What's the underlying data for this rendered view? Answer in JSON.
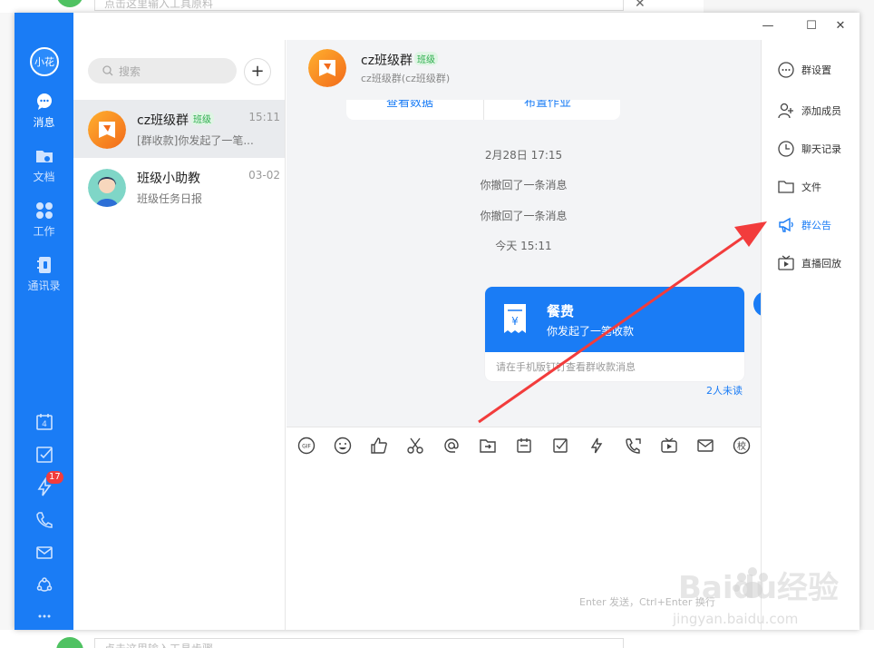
{
  "background": {
    "top_input_placeholder": "点击这里输入工具原料",
    "bottom_input_placeholder": "点击这里输入工具步骤"
  },
  "nav": {
    "avatar_text": "小花",
    "items": [
      {
        "label": "消息",
        "icon": "chat-bubble-icon"
      },
      {
        "label": "文档",
        "icon": "folder-icon"
      },
      {
        "label": "工作",
        "icon": "apps-grid-icon"
      },
      {
        "label": "通讯录",
        "icon": "contacts-icon"
      }
    ],
    "bottom_icons": [
      "calendar-icon",
      "todo-check-icon",
      "lightning-icon",
      "phone-icon",
      "mail-icon",
      "share-icon",
      "more-icon"
    ],
    "calendar_day": "4",
    "badge_count": "17"
  },
  "list": {
    "search_placeholder": "搜索",
    "add_label": "+",
    "conversations": [
      {
        "name": "cz班级群",
        "tag": "班级",
        "time": "15:11",
        "preview": "[群收款]你发起了一笔..."
      },
      {
        "name": "班级小助教",
        "time": "03-02",
        "preview": "班级任务日报"
      }
    ]
  },
  "chat": {
    "title": "cz班级群",
    "title_tag": "班级",
    "subtitle": "cz班级群(cz班级群)",
    "prev_card_left": "查看数据",
    "prev_card_right": "布置作业",
    "system_messages": [
      "2月28日 17:15",
      "你撤回了一条消息",
      "你撤回了一条消息",
      "今天 15:11"
    ],
    "payment_card": {
      "title": "餐费",
      "desc": "你发起了一笔收款",
      "footer": "请在手机版钉钉查看群收款消息"
    },
    "unread": "2人未读",
    "toolbar_icons": [
      "gif-icon",
      "emoji-icon",
      "thumbs-up-icon",
      "scissors-icon",
      "at-icon",
      "forward-icon",
      "calendar-card-icon",
      "todo-icon",
      "ding-icon",
      "call-icon",
      "live-icon",
      "mail-icon",
      "school-icon"
    ],
    "gif_label": "GIF",
    "school_label": "校",
    "hint": "Enter 发送，Ctrl+Enter 换行"
  },
  "right_panel": {
    "items": [
      {
        "label": "群设置",
        "icon": "more-circle-icon"
      },
      {
        "label": "添加成员",
        "icon": "add-member-icon"
      },
      {
        "label": "聊天记录",
        "icon": "history-clock-icon"
      },
      {
        "label": "文件",
        "icon": "folder-icon"
      },
      {
        "label": "群公告",
        "icon": "megaphone-icon",
        "active": true
      },
      {
        "label": "直播回放",
        "icon": "tv-replay-icon"
      }
    ]
  },
  "window_controls": {
    "minimize": "—",
    "maximize": "☐",
    "close": "✕"
  },
  "watermark": {
    "brand": "Baidu经验",
    "url": "jingyan.baidu.com"
  },
  "colors": {
    "primary": "#1a7cf5",
    "arrow": "#f23c3c",
    "tag_green": "#2fae4f"
  }
}
